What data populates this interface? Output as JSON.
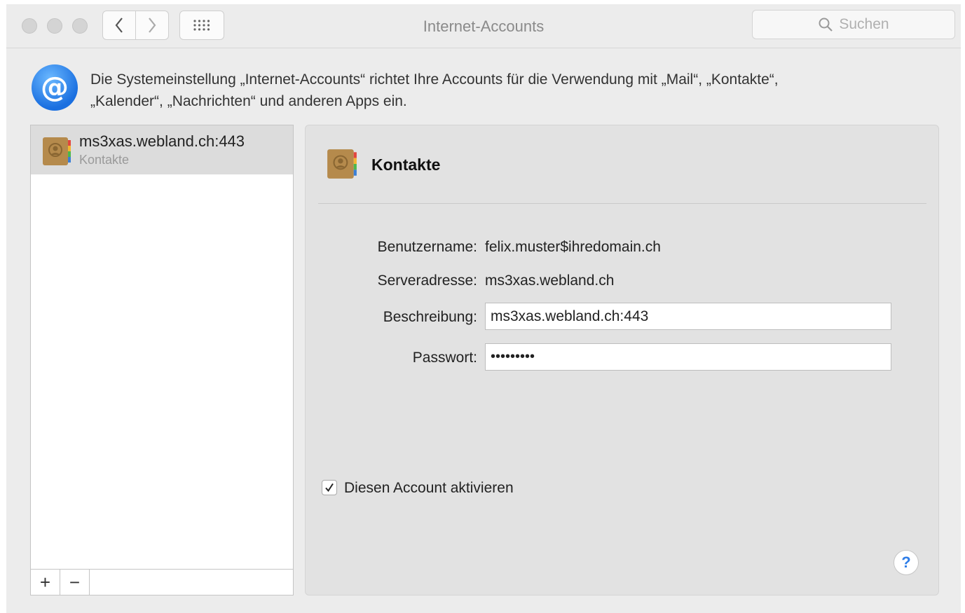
{
  "window": {
    "title": "Internet-Accounts",
    "search_placeholder": "Suchen"
  },
  "info": {
    "text_line1": "Die Systemeinstellung „Internet-Accounts“ richtet Ihre Accounts für die Verwendung mit „Mail“, „Kontakte“,",
    "text_line2": "„Kalender“, „Nachrichten“ und anderen Apps ein."
  },
  "sidebar": {
    "accounts": [
      {
        "name": "ms3xas.webland.ch:443",
        "subtitle": "Kontakte",
        "selected": true
      }
    ],
    "add_label": "+",
    "remove_label": "−"
  },
  "panel": {
    "title": "Kontakte",
    "fields": {
      "username_label": "Benutzername:",
      "username_value": "felix.muster$ihredomain.ch",
      "server_label": "Serveradresse:",
      "server_value": "ms3xas.webland.ch",
      "description_label": "Beschreibung:",
      "description_value": "ms3xas.webland.ch:443",
      "password_label": "Passwort:",
      "password_value": "•••••••••"
    },
    "enable_checkbox_label": "Diesen Account aktivieren",
    "enable_checked": true,
    "help_label": "?"
  },
  "colors": {
    "accent_blue": "#2f7ee8",
    "window_bg": "#ececec",
    "panel_bg": "#e2e2e2",
    "selection_bg": "#dcdcdc"
  }
}
